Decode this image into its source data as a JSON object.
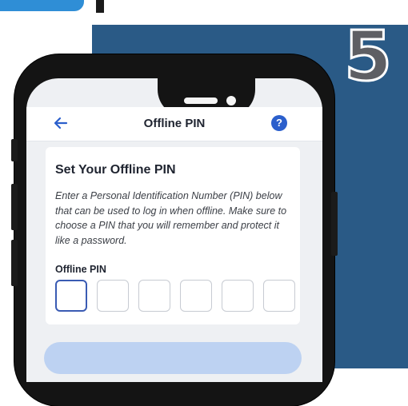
{
  "step": {
    "number": "5"
  },
  "header": {
    "back_icon": "arrow-left-icon",
    "title": "Offline PIN",
    "help_icon": "question-circle-icon",
    "help_glyph": "?"
  },
  "card": {
    "title": "Set Your Offline PIN",
    "description": "Enter a Personal Identification Number (PIN) below that can be used to log in when offline. Make sure to choose a PIN that you will remember and protect it like a password.",
    "pin_label": "Offline PIN",
    "pin_digits": 6
  },
  "colors": {
    "accent": "#2b5fcc",
    "background_panel": "#2a5a86",
    "card": "#ffffff"
  }
}
